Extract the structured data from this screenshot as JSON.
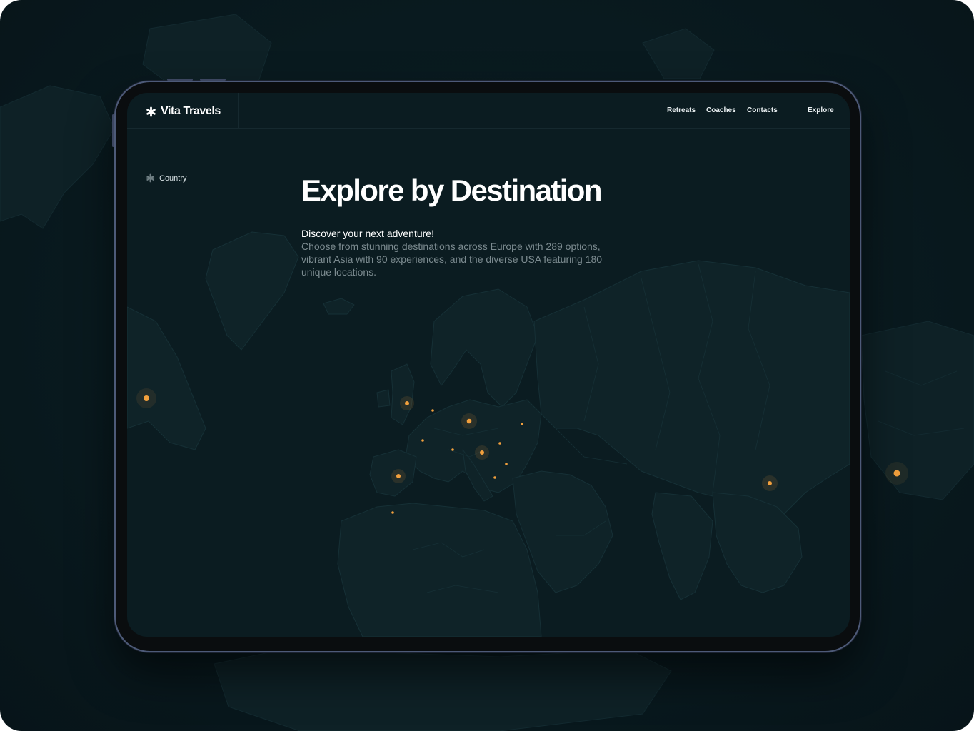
{
  "brand": {
    "name": "Vita Travels",
    "icon": "asterisk-icon"
  },
  "nav": {
    "links": [
      "Retreats",
      "Coaches",
      "Contacts",
      "Explore"
    ]
  },
  "filter": {
    "label": "Country",
    "icon": "asterisk-icon"
  },
  "hero": {
    "title": "Explore by Destination",
    "lead": "Discover your next adventure!",
    "description": "Choose from stunning destinations across Europe with 289 options, vibrant Asia with 90 experiences, and the diverse USA featuring 180 unique locations."
  },
  "colors": {
    "background": "#091a1f",
    "screen": "#0b1c21",
    "land": "#0f2328",
    "accent": "#f2a03d",
    "text_muted": "#7c8b90"
  }
}
